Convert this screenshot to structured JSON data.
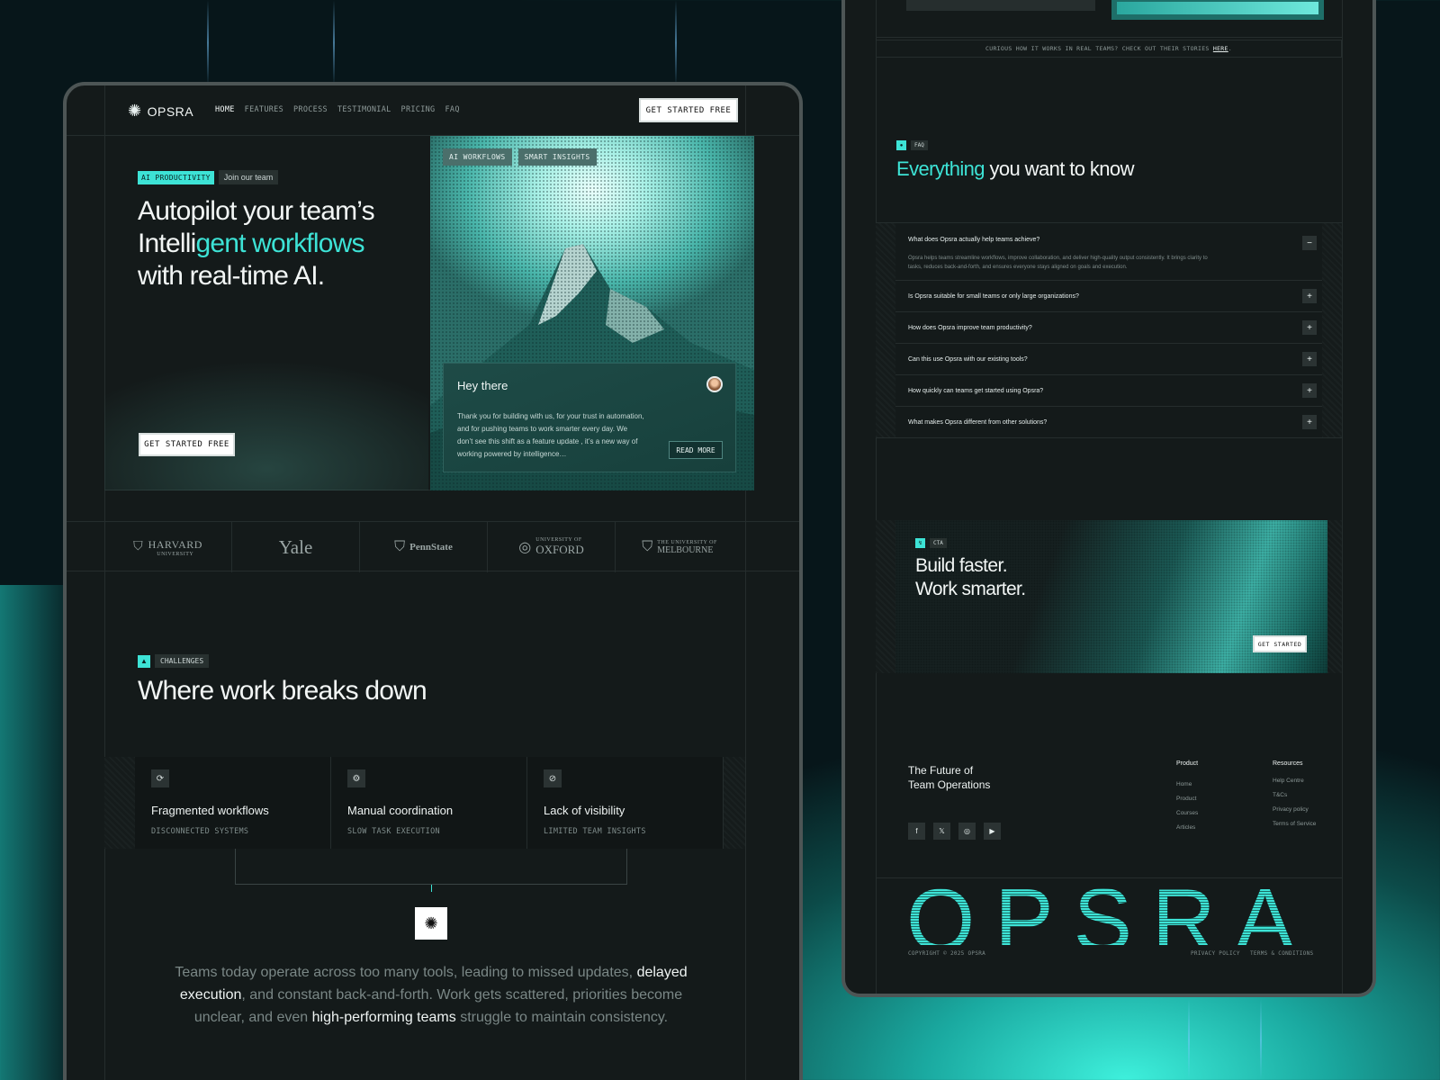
{
  "theme": {
    "accent": "#3de3d6",
    "background": "#141a1a"
  },
  "nav": {
    "brand": "OPSRA",
    "brand_icon": "sparkle-icon",
    "items": [
      "HOME",
      "FEATURES",
      "PROCESS",
      "TESTIMONIAL",
      "PRICING",
      "FAQ"
    ],
    "active": "HOME",
    "cta": "GET STARTED FREE"
  },
  "hero": {
    "badge": "AI PRODUCTIVITY",
    "badge_link": "Join our team",
    "headline_line1": "Autopilot your team’s",
    "headline_line2_plain": "Intelli",
    "headline_line2_accent": "gent workflows",
    "headline_line3": "with real-time AI.",
    "cta": "GET STARTED FREE",
    "image_tags": [
      "AI WORKFLOWS",
      "SMART INSIGHTS"
    ],
    "card": {
      "title": "Hey there",
      "text": "Thank you for building with us, for your trust in automation, and for pushing teams to work smarter every day. We don’t see this shift as a feature update , it’s a new way of working powered by intelligence…",
      "button": "READ MORE"
    }
  },
  "logos": [
    {
      "name": "HARVARD",
      "sub": "UNIVERSITY"
    },
    {
      "name": "Yale",
      "sub": ""
    },
    {
      "name": "PennState",
      "sub": ""
    },
    {
      "name": "OXFORD",
      "sub": "UNIVERSITY OF"
    },
    {
      "name": "MELBOURNE",
      "sub": "THE UNIVERSITY OF"
    }
  ],
  "challenges": {
    "badge": "CHALLENGES",
    "title": "Where work breaks down",
    "items": [
      {
        "title": "Fragmented workflows",
        "sub": "DISCONNECTED SYSTEMS",
        "icon": "refresh-icon"
      },
      {
        "title": "Manual coordination",
        "sub": "SLOW TASK EXECUTION",
        "icon": "gear-icon"
      },
      {
        "title": "Lack of visibility",
        "sub": "LIMITED TEAM INSIGHTS",
        "icon": "eye-off-icon"
      }
    ],
    "para_1": "Teams today operate across too many tools, leading to missed updates,",
    "para_2": "delayed execution",
    "para_3": ", and constant back-and-forth. Work gets scattered, priorities become unclear, and even",
    "para_4": "high-performing teams",
    "para_5": "struggle to maintain consistency."
  },
  "stories": {
    "text": "CURIOUS HOW IT WORKS IN REAL TEAMS? CHECK OUT THEIR STORIES",
    "link": "HERE",
    "end": "."
  },
  "faq": {
    "badge": "FAQ",
    "title_accent": "Everything",
    "title_rest": "you want to know",
    "items": [
      {
        "q": "What does Opsra actually help teams achieve?",
        "a": "Opsra helps teams streamline workflows, improve collaboration, and deliver high-quality output consistently. It brings clarity to tasks, reduces back-and-forth, and ensures everyone stays aligned on goals and execution.",
        "toggle": "−"
      },
      {
        "q": "Is Opsra suitable for small teams or only large organizations?",
        "toggle": "+"
      },
      {
        "q": "How does Opsra improve team productivity?",
        "toggle": "+"
      },
      {
        "q": "Can this use Opsra with our existing tools?",
        "toggle": "+"
      },
      {
        "q": "How quickly can teams get started using Opsra?",
        "toggle": "+"
      },
      {
        "q": "What makes Opsra different from other solutions?",
        "toggle": "+"
      }
    ]
  },
  "cta": {
    "badge": "CTA",
    "line1": "Build faster.",
    "line2": "Work smarter.",
    "button": "GET STARTED"
  },
  "footer": {
    "tagline_1": "The Future of",
    "tagline_2": "Team Operations",
    "socials": [
      {
        "icon": "facebook-icon",
        "glyph": "f"
      },
      {
        "icon": "x-icon",
        "glyph": "𝕏"
      },
      {
        "icon": "instagram-icon",
        "glyph": "◎"
      },
      {
        "icon": "youtube-icon",
        "glyph": "▶"
      }
    ],
    "product_heading": "Product",
    "product_links": [
      "Home",
      "Product",
      "Courses",
      "Articles"
    ],
    "resources_heading": "Resources",
    "resources_links": [
      "Help Centre",
      "T&Cs",
      "Privacy policy",
      "Terms of Service"
    ],
    "big_word": "OPSRA",
    "copyright": "COPYRIGHT © 2025 OPSRA",
    "privacy": "PRIVACY POLICY",
    "terms": "TERMS & CONDITIONS"
  }
}
